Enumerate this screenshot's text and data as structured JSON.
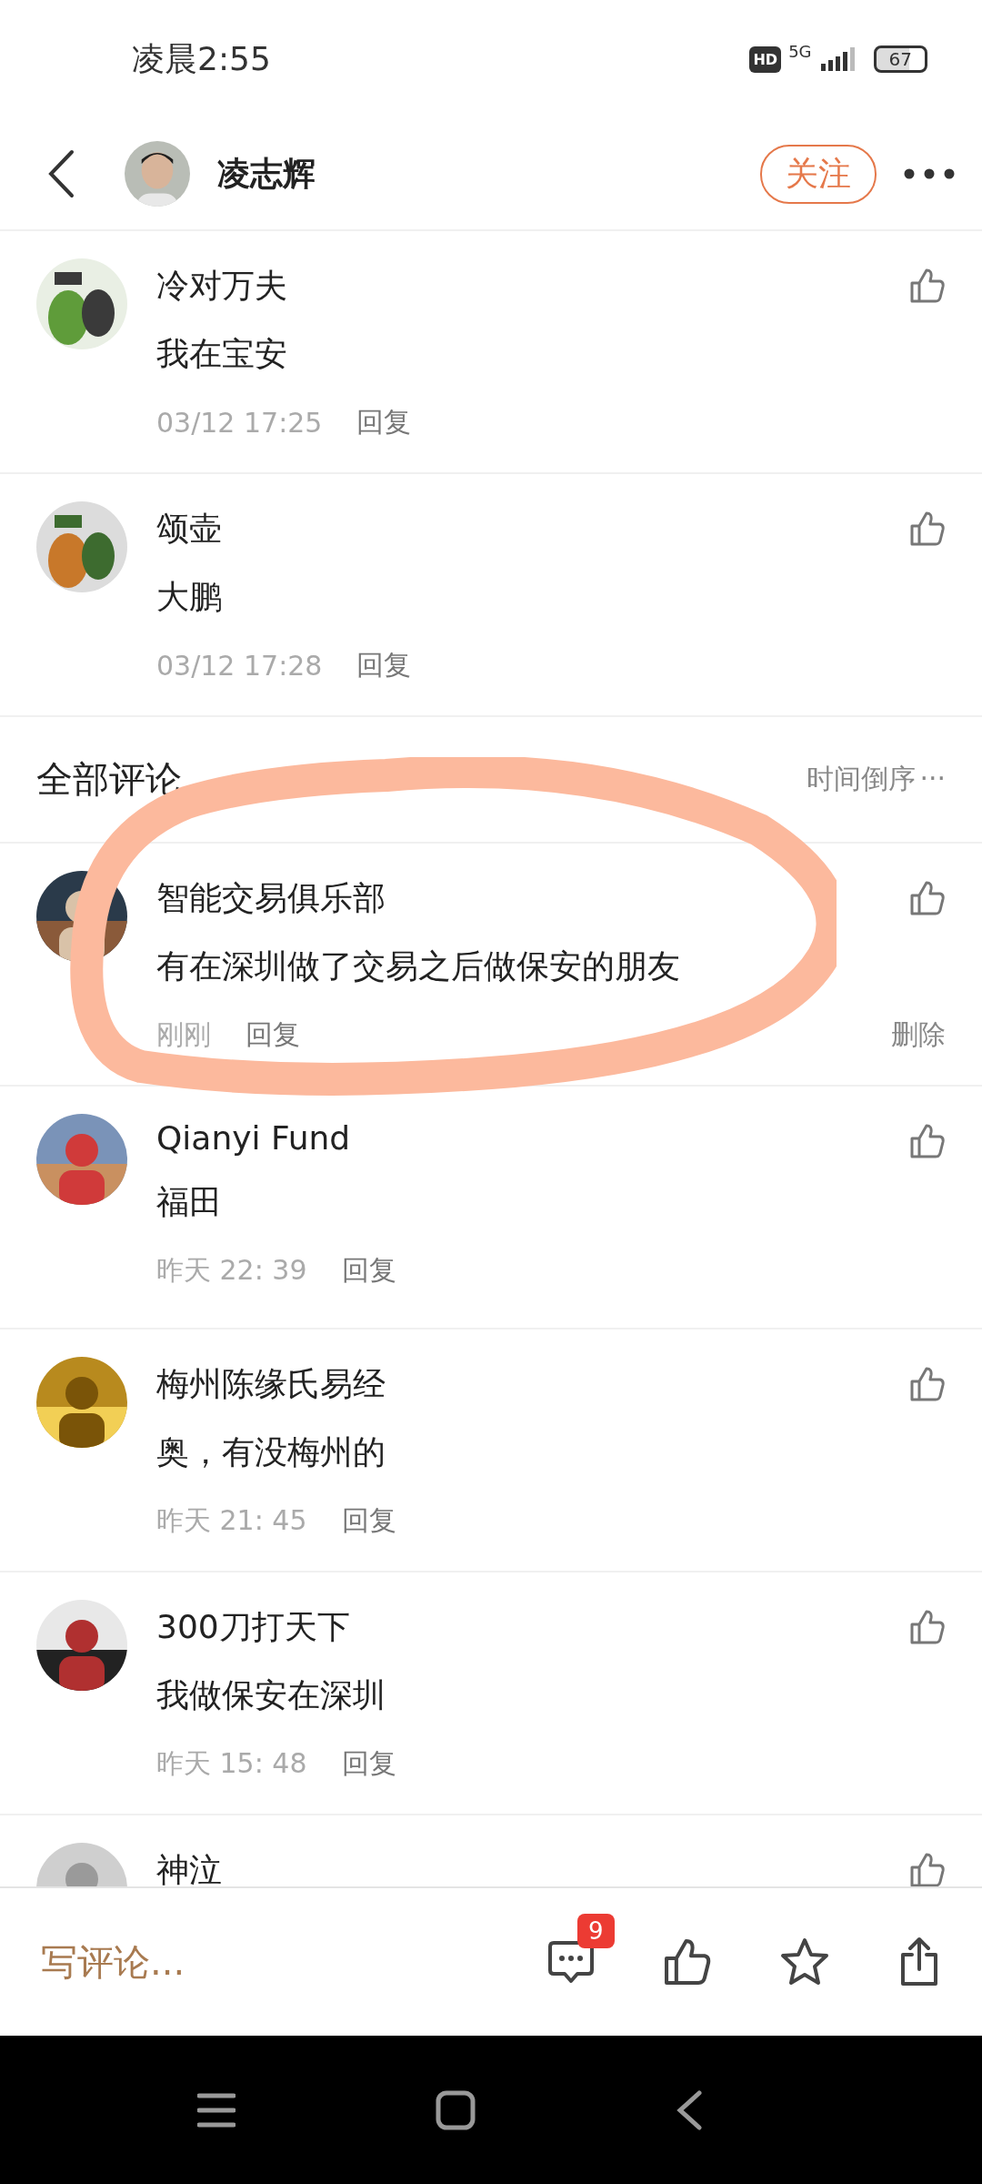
{
  "status_bar": {
    "time": "凌晨2:55",
    "hd": "HD",
    "network": "5G",
    "battery": "67"
  },
  "header": {
    "user_name": "凌志辉",
    "follow_label": "关注"
  },
  "top_comments": [
    {
      "name": "冷对万夫",
      "text": "我在宝安",
      "time": "03/12 17:25",
      "reply_label": "回复"
    },
    {
      "name": "颂壶",
      "text": "大鹏",
      "time": "03/12 17:28",
      "reply_label": "回复"
    }
  ],
  "all_comments": {
    "title": "全部评论",
    "sort_label": "时间倒序",
    "sort_more": "···",
    "items": [
      {
        "name": "智能交易俱乐部",
        "text": "有在深圳做了交易之后做保安的朋友",
        "time": "刚刚",
        "reply_label": "回复",
        "delete_label": "删除",
        "circled": true
      },
      {
        "name": "Qianyi Fund",
        "text": "福田",
        "time": "昨天 22: 39",
        "reply_label": "回复",
        "circled": false
      },
      {
        "name": "梅州陈缘氏易经",
        "text": "奥，有没梅州的",
        "time": "昨天 21: 45",
        "reply_label": "回复",
        "circled": false
      },
      {
        "name": "300刀打天下",
        "text": "我做保安在深圳",
        "time": "昨天 15: 48",
        "reply_label": "回复",
        "circled": false
      },
      {
        "name": "神泣",
        "circled": false
      }
    ]
  },
  "bottom_bar": {
    "placeholder": "写评论...",
    "comment_count": "9"
  }
}
